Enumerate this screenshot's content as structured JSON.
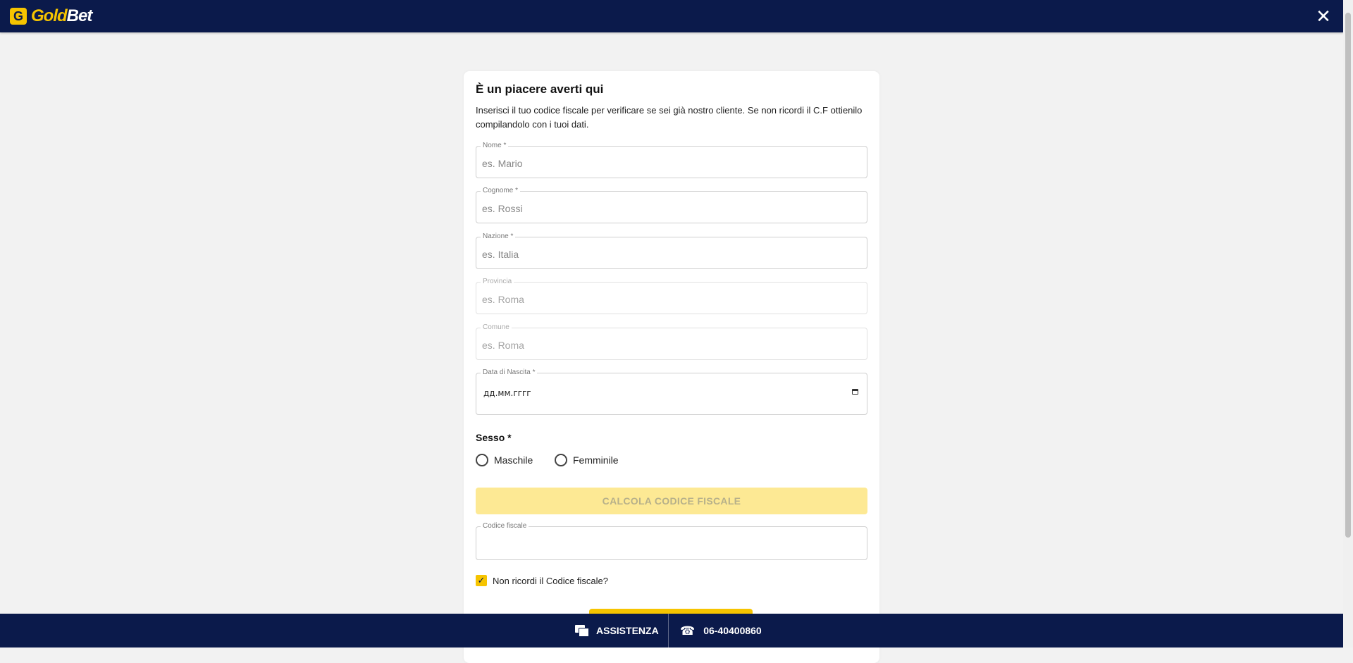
{
  "header": {
    "logo_mark": "G",
    "logo_gold": "Gold",
    "logo_bet": "Bet",
    "close_symbol": "✕"
  },
  "form": {
    "title": "È un piacere averti qui",
    "description": "Inserisci il tuo codice fiscale per verificare se sei già nostro cliente. Se non ricordi il C.F ottienilo compilandolo con i tuoi dati.",
    "fields": {
      "nome": {
        "label": "Nome *",
        "placeholder": "es. Mario"
      },
      "cognome": {
        "label": "Cognome *",
        "placeholder": "es. Rossi"
      },
      "nazione": {
        "label": "Nazione *",
        "placeholder": "es. Italia"
      },
      "provincia": {
        "label": "Provincia",
        "placeholder": "es. Roma"
      },
      "comune": {
        "label": "Comune",
        "placeholder": "es. Roma"
      },
      "data_nascita": {
        "label": "Data di Nascita *",
        "value": "дд.мм.гггг"
      },
      "codice_fiscale": {
        "label": "Codice fiscale",
        "placeholder": ""
      }
    },
    "sesso": {
      "label": "Sesso *",
      "options": [
        "Maschile",
        "Femminile"
      ]
    },
    "calc_button": "CALCOLA CODICE FISCALE",
    "checkbox": {
      "label": "Non ricordi il Codice fiscale?",
      "checked": true,
      "symbol": "✓"
    }
  },
  "footer": {
    "assistenza": "ASSISTENZA",
    "phone": "06-40400860"
  },
  "colors": {
    "navy": "#0b1a4b",
    "gold": "#f6c400",
    "button_disabled": "#fde994"
  },
  "icons": [
    "close-icon",
    "chat-icon",
    "phone-icon",
    "calendar-icon",
    "check-icon"
  ]
}
